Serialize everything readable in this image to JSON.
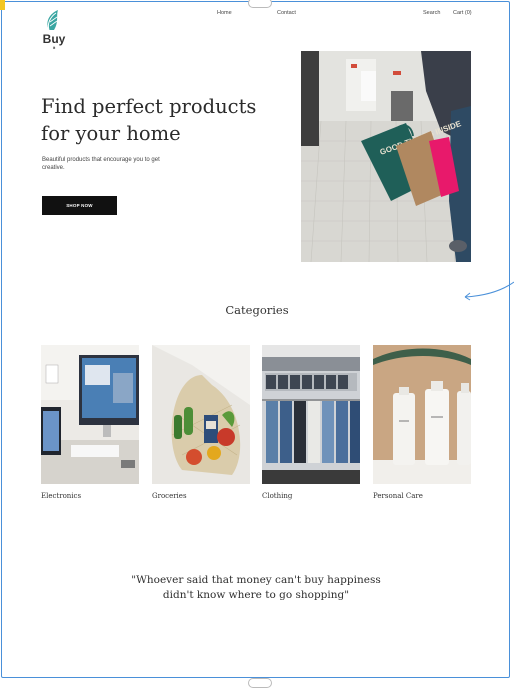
{
  "logo": {
    "name": "Buy",
    "sub": "it"
  },
  "nav": {
    "home": "Home",
    "contact": "Contact",
    "search": "Search",
    "cart": "Cart (0)"
  },
  "hero": {
    "title_line1": "Find perfect products",
    "title_line2": "for your home",
    "subtitle": "Beautiful products that encourage you to get creative.",
    "cta": "SHOP NOW",
    "bag_text": "GOOD THINGS INSIDE"
  },
  "categories": {
    "title": "Categories",
    "items": [
      {
        "label": "Electronics"
      },
      {
        "label": "Groceries"
      },
      {
        "label": "Clothing"
      },
      {
        "label": "Personal Care"
      }
    ]
  },
  "quote": "\"Whoever said that money can't buy happiness didn't know where to go shopping\"",
  "colors": {
    "accent": "#111111",
    "frame": "#4a90d9",
    "logo": "#3aa6a2"
  }
}
